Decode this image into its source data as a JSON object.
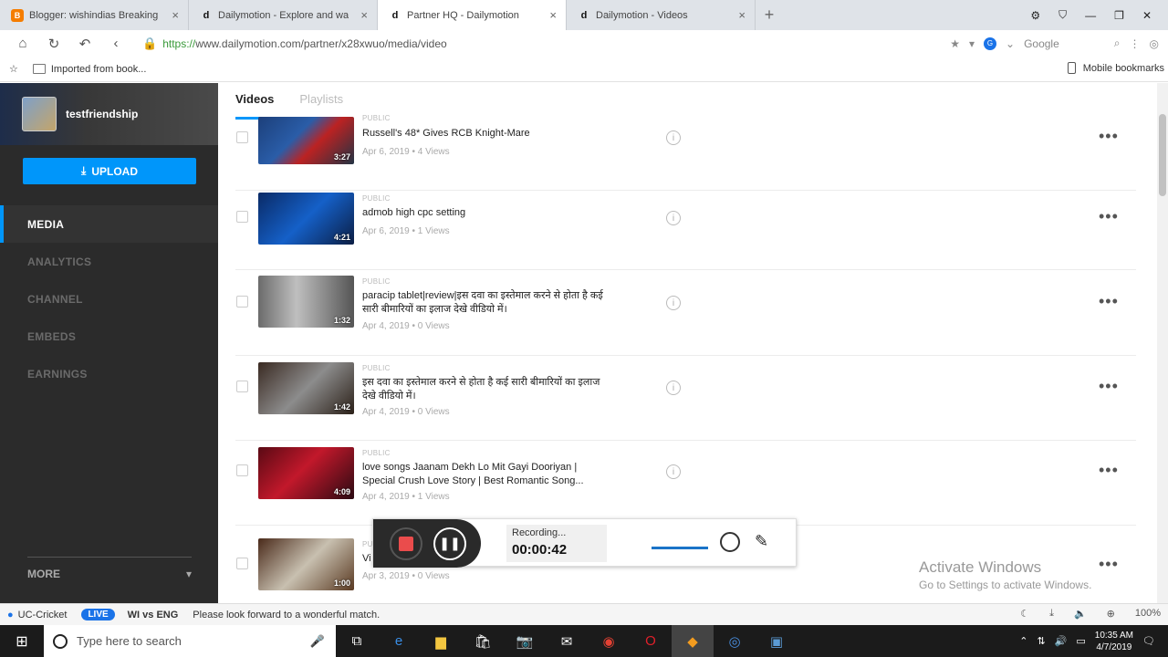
{
  "browser": {
    "tabs": [
      {
        "title": "Blogger: wishindias Breaking",
        "favicon": "blogger-icon",
        "active": false
      },
      {
        "title": "Dailymotion - Explore and wa",
        "favicon": "dailymotion-icon",
        "active": false
      },
      {
        "title": "Partner HQ - Dailymotion",
        "favicon": "dailymotion-icon",
        "active": true
      },
      {
        "title": "Dailymotion - Videos",
        "favicon": "dailymotion-icon",
        "active": false
      }
    ],
    "url_scheme": "https://",
    "url_rest": "www.dailymotion.com/partner/x28xwuo/media/video",
    "search_engine": "Google",
    "bookmark_folder": "Imported from book...",
    "mobile_bookmarks": "Mobile bookmarks"
  },
  "sidebar": {
    "username": "testfriendship",
    "upload_label": "UPLOAD",
    "items": [
      {
        "label": "MEDIA",
        "active": true
      },
      {
        "label": "ANALYTICS",
        "active": false
      },
      {
        "label": "CHANNEL",
        "active": false
      },
      {
        "label": "EMBEDS",
        "active": false
      },
      {
        "label": "EARNINGS",
        "active": false
      }
    ],
    "more_label": "MORE",
    "more_caret": "▾"
  },
  "main": {
    "tabs": [
      "Videos",
      "Playlists"
    ],
    "videos": [
      {
        "visibility": "PUBLIC",
        "title": "Russell's 48* Gives RCB Knight-Mare",
        "meta": "Apr 6, 2019 • 4 Views",
        "duration": "3:27"
      },
      {
        "visibility": "PUBLIC",
        "title": "admob high cpc setting",
        "meta": "Apr 6, 2019 • 1 Views",
        "duration": "4:21"
      },
      {
        "visibility": "PUBLIC",
        "title": "paracip tablet|review|इस दवा का इस्तेमाल करने से होता है कई सारी बीमारियों का इलाज देखे वीडियो में।",
        "meta": "Apr 4, 2019 • 0 Views",
        "duration": "1:32"
      },
      {
        "visibility": "PUBLIC",
        "title": "इस दवा का इस्तेमाल करने से होता है कई सारी बीमारियों का इलाज देखे वीडियो में।",
        "meta": "Apr 4, 2019 • 0 Views",
        "duration": "1:42"
      },
      {
        "visibility": "PUBLIC",
        "title": "love songs Jaanam Dekh Lo Mit Gayi Dooriyan | Special Crush Love Story | Best Romantic Song...",
        "meta": "Apr 4, 2019 • 1 Views",
        "duration": "4:09"
      },
      {
        "visibility": "PUBLIC",
        "title": "Vi",
        "meta": "Apr 3, 2019 • 0 Views",
        "duration": "1:00"
      }
    ],
    "info_glyph": "i",
    "more_glyph": "•••"
  },
  "recorder": {
    "status": "Recording...",
    "time": "00:00:42"
  },
  "activation": {
    "title": "Activate Windows",
    "subtitle": "Go to Settings to activate Windows."
  },
  "statusbar": {
    "news_source": "UC-Cricket",
    "live_badge": "LIVE",
    "score": "WI vs ENG",
    "message": "Please look forward to a wonderful match.",
    "zoom": "100%"
  },
  "taskbar": {
    "search_placeholder": "Type here to search",
    "time": "10:35 AM",
    "date": "4/7/2019"
  }
}
